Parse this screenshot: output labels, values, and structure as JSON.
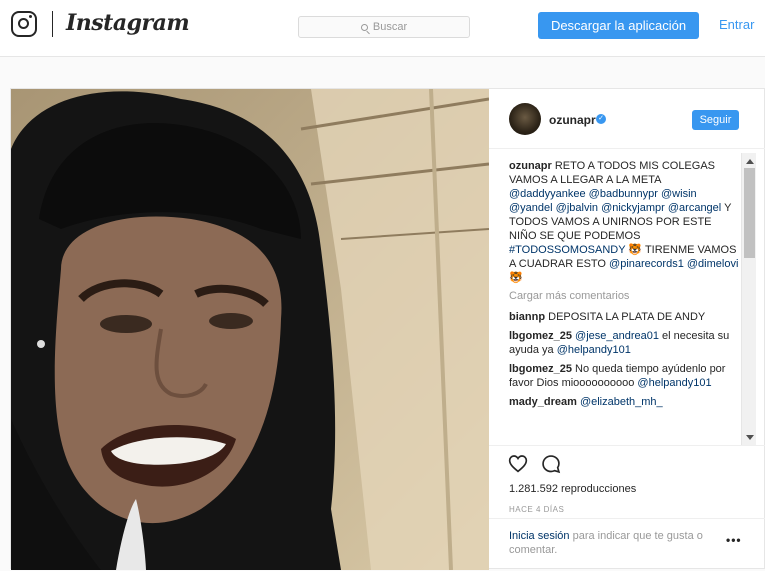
{
  "topbar": {
    "wordmark": "Instagram",
    "search_placeholder": "Buscar",
    "download_button": "Descargar la aplicación",
    "login_link": "Entrar"
  },
  "post": {
    "username": "ozunapr",
    "follow_button": "Seguir",
    "caption": {
      "author": "ozunapr",
      "text_1": " RETO A TODOS MIS COLEGAS VAMOS A LLEGAR A LA META ",
      "mentions_1": [
        "@daddyyankee",
        "@badbunnypr",
        "@wisin",
        "@yandel",
        "@jbalvin",
        "@nickyjampr",
        "@arcangel"
      ],
      "text_2": " Y TODOS VAMOS A UNIRNOS POR ESTE NIÑO SE QUE PODEMOS ",
      "hashtag": "#TODOSSOMOSANDY",
      "text_3": " 🐯 TIRENME VAMOS A CUADRAR ESTO ",
      "mentions_2": [
        "@pinarecords1",
        "@dimelovi"
      ],
      "text_4": " 🐯"
    },
    "load_more": "Cargar más comentarios",
    "comments": [
      {
        "user": "biannp",
        "text": " DEPOSITA LA PLATA DE ANDY",
        "mention": "",
        "after": ""
      },
      {
        "user": "lbgomez_25",
        "text": " ",
        "mention": "@jese_andrea01",
        "after": " el necesita su ayuda ya "
      },
      {
        "user": "lbgomez_25",
        "text": " No queda tiempo ayúdenlo por favor Dios mioooooooooo ",
        "mention": "@helpandy101",
        "after": ""
      },
      {
        "user": "mady_dream",
        "text": " ",
        "mention": "@elizabeth_mh_",
        "after": ""
      }
    ],
    "comment_2_extra": "@helpandy101",
    "views_count": "1.281.592",
    "views_label": "reproducciones",
    "time_ago": "HACE 4 DÍAS",
    "login_prompt_link": "Inicia sesión",
    "login_prompt_text": " para indicar que te gusta o comentar.",
    "more_options": "•••",
    "colors": {
      "accent": "#3897f0",
      "link": "#003569",
      "muted": "#999999"
    }
  }
}
